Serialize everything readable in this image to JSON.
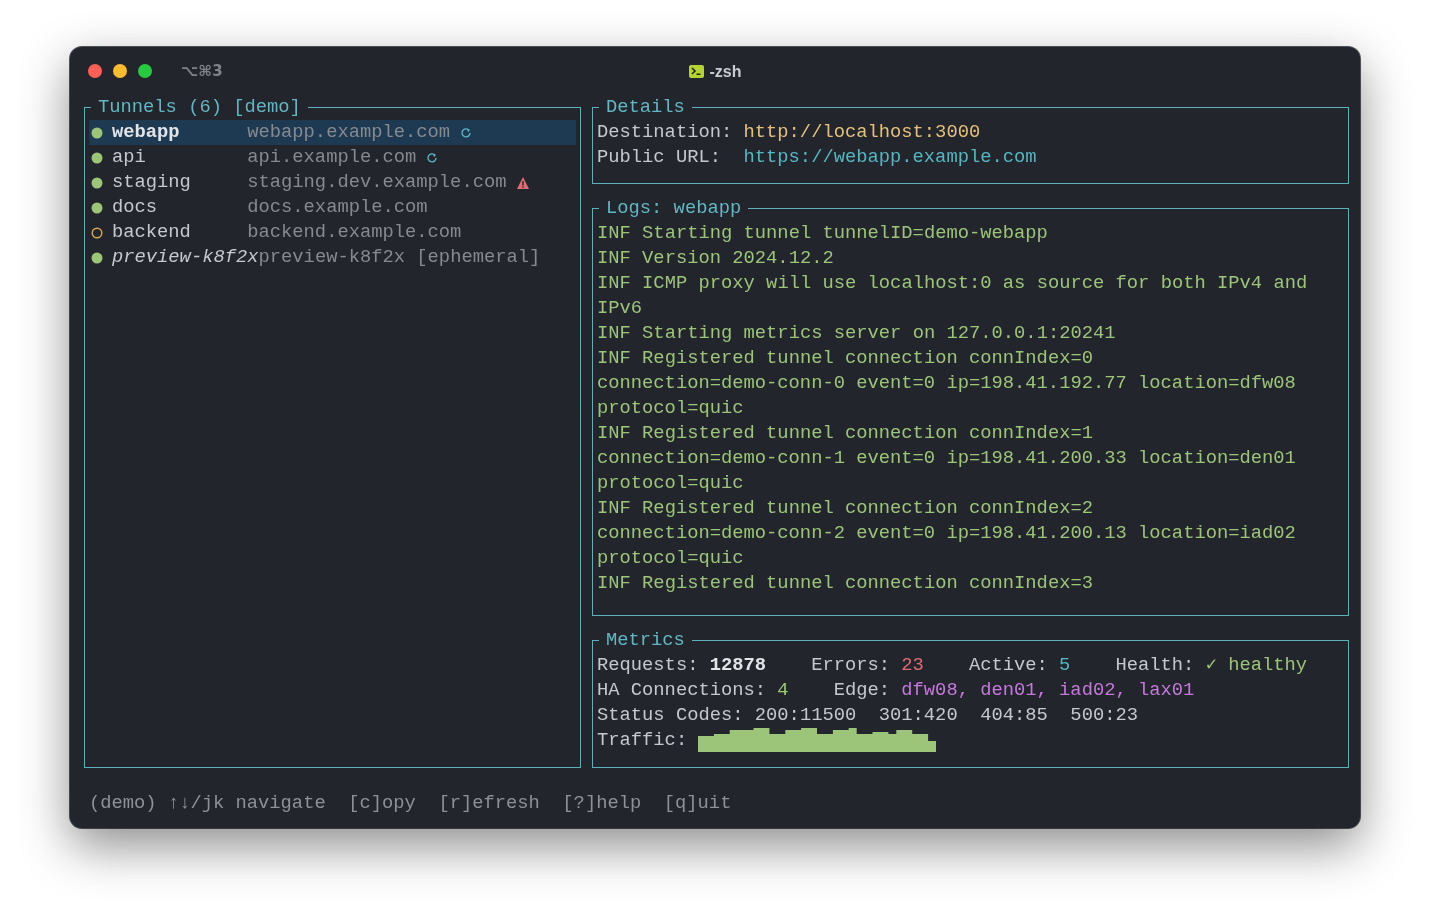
{
  "window": {
    "title": "-zsh",
    "shortcut": "⌥⌘3"
  },
  "tunnels_panel": {
    "title": "Tunnels (6) [demo]",
    "items": [
      {
        "name": "webapp",
        "host": "webapp.example.com",
        "active": true,
        "syncing": true,
        "warning": false,
        "selected": true,
        "ephemeral": false
      },
      {
        "name": "api",
        "host": "api.example.com",
        "active": true,
        "syncing": true,
        "warning": false,
        "selected": false,
        "ephemeral": false
      },
      {
        "name": "staging",
        "host": "staging.dev.example.com",
        "active": true,
        "syncing": false,
        "warning": true,
        "selected": false,
        "ephemeral": false
      },
      {
        "name": "docs",
        "host": "docs.example.com",
        "active": true,
        "syncing": false,
        "warning": false,
        "selected": false,
        "ephemeral": false
      },
      {
        "name": "backend",
        "host": "backend.example.com",
        "active": false,
        "syncing": false,
        "warning": false,
        "selected": false,
        "ephemeral": false
      },
      {
        "name": "preview-k8f2x",
        "host": "preview-k8f2x [ephemeral]",
        "active": true,
        "syncing": false,
        "warning": false,
        "selected": false,
        "ephemeral": true
      }
    ]
  },
  "details": {
    "title": "Details",
    "fields": [
      {
        "label": "Destination:",
        "value": "http://localhost:3000",
        "kind": "local"
      },
      {
        "label": "Public URL:",
        "value": "https://webapp.example.com",
        "kind": "public"
      }
    ]
  },
  "logs": {
    "title": "Logs: webapp",
    "lines": [
      "INF Starting tunnel tunnelID=demo-webapp",
      "INF Version 2024.12.2",
      "INF ICMP proxy will use localhost:0 as source for both IPv4 and IPv6",
      "INF Starting metrics server on 127.0.0.1:20241",
      "INF Registered tunnel connection connIndex=0 connection=demo-conn-0 event=0 ip=198.41.192.77 location=dfw08 protocol=quic",
      "INF Registered tunnel connection connIndex=1 connection=demo-conn-1 event=0 ip=198.41.200.33 location=den01 protocol=quic",
      "INF Registered tunnel connection connIndex=2 connection=demo-conn-2 event=0 ip=198.41.200.13 location=iad02 protocol=quic",
      "INF Registered tunnel connection connIndex=3"
    ]
  },
  "metrics": {
    "title": "Metrics",
    "rows": [
      [
        {
          "label": "Requests:",
          "value": "12878",
          "kind": "strong"
        },
        {
          "label": "Errors:",
          "value": "23",
          "kind": "error"
        },
        {
          "label": "Active:",
          "value": "5",
          "kind": "info"
        },
        {
          "label": "Health:",
          "value": "✓ healthy",
          "kind": "ok"
        }
      ],
      [
        {
          "label": "HA Connections:",
          "value": "4",
          "kind": "ok"
        },
        {
          "label": "Edge:",
          "value": "dfw08, den01, iad02, lax01",
          "kind": "edge"
        }
      ]
    ],
    "status_codes": {
      "label": "Status Codes:",
      "codes": [
        "200:11500",
        "301:420",
        "404:85",
        "500:23"
      ]
    },
    "traffic": {
      "label": "Traffic:",
      "kind": "sparkline"
    }
  },
  "status_bar": {
    "hints": [
      "(demo) ↑↓/jk navigate",
      "[c]opy",
      "[r]efresh",
      "[?]help",
      "[q]uit"
    ]
  }
}
